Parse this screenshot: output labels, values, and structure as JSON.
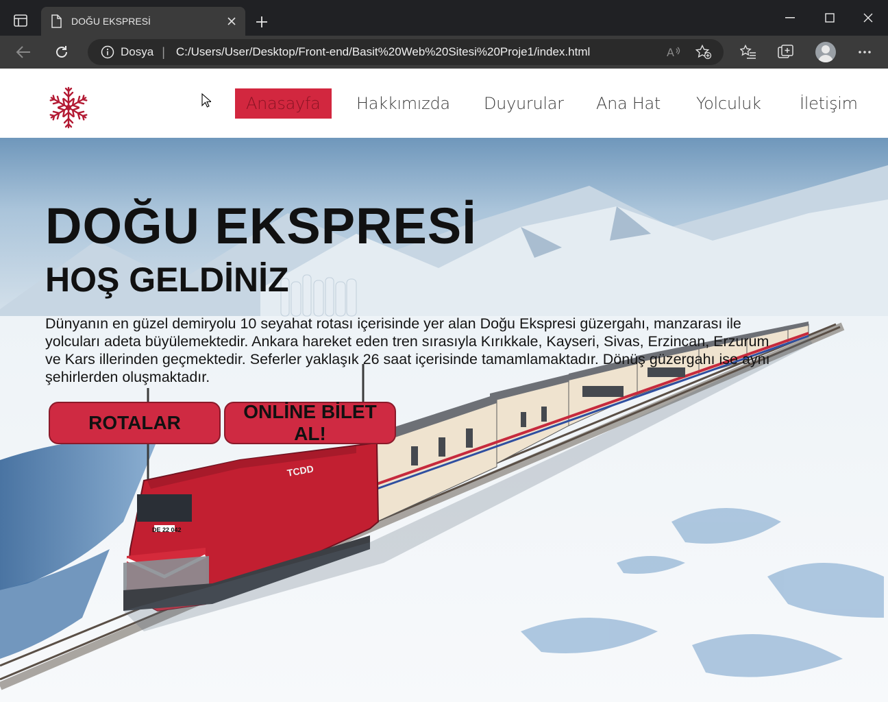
{
  "browser": {
    "tab_title": "DOĞU EKSPRESİ",
    "site_label": "Dosya",
    "url": "C:/Users/User/Desktop/Front-end/Basit%20Web%20Sitesi%20Proje1/index.html"
  },
  "nav": {
    "items": [
      {
        "label": "Anasayfa",
        "active": true
      },
      {
        "label": "Hakkımızda"
      },
      {
        "label": "Duyurular"
      },
      {
        "label": "Ana Hat"
      },
      {
        "label": "Yolculuk"
      },
      {
        "label": "İletişim"
      }
    ]
  },
  "hero": {
    "title": "DOĞU EKSPRESİ",
    "subtitle": "HOŞ GELDİNİZ",
    "text": "Dünyanın en güzel demiryolu 10 seyahat rotası içerisinde yer alan Doğu Ekspresi güzergahı, manzarası ile yolcuları adeta büyülemektedir. Ankara hareket eden tren sırasıyla Kırıkkale, Kayseri, Sivas, Erzincan, Erzurum ve Kars illerinden geçmektedir. Seferler yaklaşık 26 saat içerisinde tamamlamaktadır. Dönüş güzergahı ise aynı şehirlerden oluşmaktadır.",
    "btn_routes": "ROTALAR",
    "btn_ticket": "ONLİNE BİLET AL!",
    "locomotive_label": "DE 22 042",
    "locomotive_brand": "TCDD"
  },
  "colors": {
    "accent": "#d2273f",
    "button": "#cf2a42",
    "logo": "#b31b34"
  }
}
